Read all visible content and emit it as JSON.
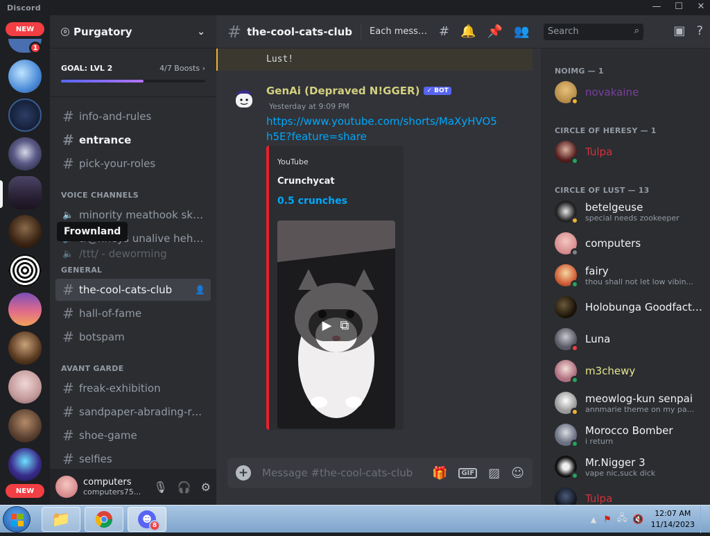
{
  "app": {
    "title": "Discord",
    "window_controls": [
      "—",
      "☐",
      "✕"
    ]
  },
  "server_rail": {
    "new_label_top": "NEW",
    "new_label_bottom": "NEW",
    "top_badge": "1"
  },
  "server": {
    "name": "Purgatory",
    "goal_label": "GOAL: LVL 2",
    "boosts": "4/7 Boosts",
    "boost_progress": 0.57
  },
  "channels": {
    "top": [
      {
        "label": "info-and-rules"
      },
      {
        "label": "entrance"
      },
      {
        "label": "pick-your-roles"
      }
    ],
    "voice_category": "VOICE CHANNELS",
    "voice": [
      {
        "label": "minority meathook ski lif..."
      },
      {
        "label": "tr@nneys unalive heheh..."
      },
      {
        "label": "/ttt/ - deworming"
      }
    ],
    "general_category": "GENERAL",
    "general": [
      {
        "label": "the-cool-cats-club"
      },
      {
        "label": "hall-of-fame"
      },
      {
        "label": "botspam"
      }
    ],
    "avant_category": "AVANT GARDE",
    "avant": [
      {
        "label": "freak-exhibition"
      },
      {
        "label": "sandpaper-abrading-roo..."
      },
      {
        "label": "shoe-game"
      },
      {
        "label": "selfies"
      }
    ],
    "tooltip": "Frownland"
  },
  "user": {
    "name": "computers",
    "tag": "computers75..."
  },
  "header": {
    "channel": "the-cool-cats-club",
    "topic": "Each message...",
    "search_placeholder": "Search"
  },
  "system_message": {
    "text": "Lust!"
  },
  "message": {
    "author": "GenAi (Depraved N!GGER)",
    "bot_label": "✓ BOT",
    "timestamp": "Yesterday at 9:09 PM",
    "link": "https://www.youtube.com/shorts/MaXyHVO5h5E?feature=share",
    "embed": {
      "provider": "YouTube",
      "title": "Crunchycat",
      "subtitle": "0.5 crunches"
    }
  },
  "composer": {
    "placeholder": "Message #the-cool-cats-club",
    "gif_label": "GIF"
  },
  "members": {
    "groups": [
      {
        "title": "NOIMG — 1"
      },
      {
        "title": "CIRCLE OF HERESY — 1"
      },
      {
        "title": "CIRCLE OF LUST — 13"
      }
    ],
    "list": [
      {
        "name": "novakaine",
        "status_text": "",
        "color": "#7b3fa0"
      },
      {
        "name": "Tulpa",
        "status_text": "",
        "color": "#d4323c"
      },
      {
        "name": "betelgeuse",
        "status_text": "special needs zookeeper",
        "color": "#f2f3f5"
      },
      {
        "name": "computers",
        "status_text": "",
        "color": "#f2f3f5"
      },
      {
        "name": "fairy",
        "status_text": "thou shall not let low vibin...",
        "color": "#f2f3f5"
      },
      {
        "name": "Holobunga Goodfacts...",
        "status_text": "",
        "color": "#f2f3f5"
      },
      {
        "name": "Luna",
        "status_text": "",
        "color": "#f2f3f5"
      },
      {
        "name": "m3chewy",
        "status_text": "",
        "color": "#e7e58c"
      },
      {
        "name": "meowlog-kun senpai",
        "status_text": "annmarie theme on my pa...",
        "color": "#f2f3f5"
      },
      {
        "name": "Morocco Bomber",
        "status_text": "i return",
        "color": "#f2f3f5"
      },
      {
        "name": "Mr.Nigger 3",
        "status_text": "vape nic,suck dick",
        "color": "#f2f3f5"
      },
      {
        "name": "Tulpa",
        "status_text": "",
        "color": "#d4323c"
      }
    ]
  },
  "taskbar": {
    "time": "12:07 AM",
    "date": "11/14/2023",
    "discord_badge": "8"
  },
  "colors": {
    "accent": "#5865f2",
    "link": "#00a8fc",
    "online": "#23a55a",
    "idle": "#f0b232",
    "dnd": "#f23f43"
  }
}
